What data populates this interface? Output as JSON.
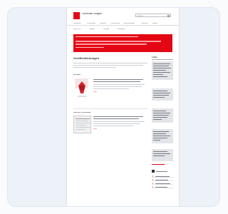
{
  "header": {
    "logo_text": "Universität Stuttgart",
    "search_placeholder": "Suche"
  },
  "main_nav": [
    "Startseite",
    "Universität",
    "Studium",
    "Forschung",
    "Einrichtungen",
    "Transfer",
    "Leben"
  ],
  "sub_nav": [
    "Über uns",
    "Presse",
    "Kontakt",
    "Aktuelles"
  ],
  "page": {
    "title": "Veröffentlichungen",
    "section1_label": "Im Blick",
    "section2_label": "Aus der Forschung",
    "more_link": "mehr"
  },
  "sidebar": {
    "links_label": "Links"
  },
  "colors": {
    "brand_red": "#e30613",
    "background": "#edf1f8"
  }
}
